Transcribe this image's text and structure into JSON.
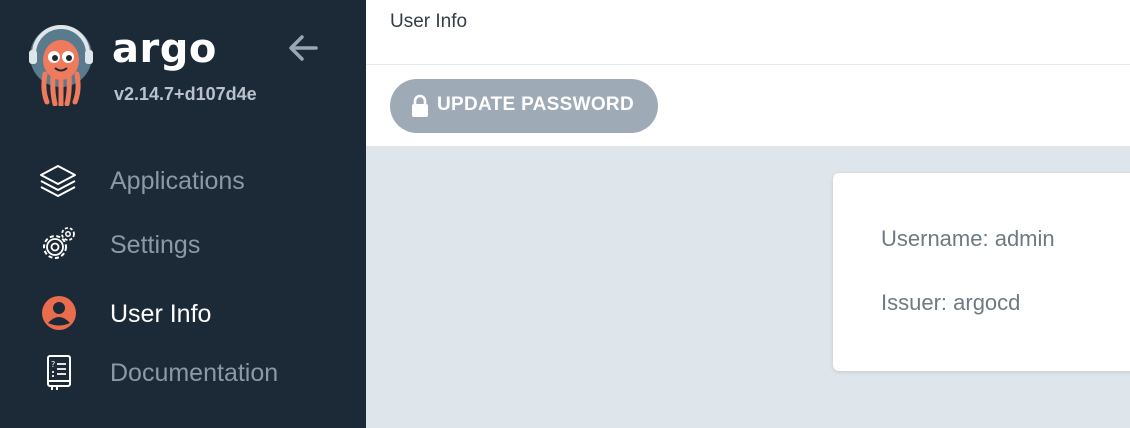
{
  "sidebar": {
    "brand": "argo",
    "version": "v2.14.7+d107d4e",
    "items": [
      {
        "label": "Applications",
        "icon": "layers-icon",
        "active": false
      },
      {
        "label": "Settings",
        "icon": "gears-icon",
        "active": false
      },
      {
        "label": "User Info",
        "icon": "user-circle-icon",
        "active": true
      },
      {
        "label": "Documentation",
        "icon": "book-icon",
        "active": false
      }
    ]
  },
  "header": {
    "title": "User Info"
  },
  "toolbar": {
    "update_password_label": "UPDATE PASSWORD",
    "icon": "lock-icon"
  },
  "user_info": {
    "username_line": "Username: admin",
    "issuer_line": "Issuer: argocd"
  },
  "colors": {
    "sidebar_bg": "#1b2a36",
    "accent": "#e96d4c",
    "button_bg": "#9eaab5",
    "content_bg": "#dee6eb"
  }
}
